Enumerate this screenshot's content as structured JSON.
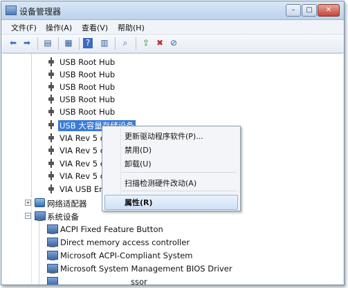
{
  "window": {
    "title": "设备管理器",
    "buttons": {
      "minimize": "–",
      "maximize": "□",
      "close": "✕"
    }
  },
  "menubar": {
    "items": [
      "文件(F)",
      "操作(A)",
      "查看(V)",
      "帮助(H)"
    ]
  },
  "toolbar": {
    "icons": [
      "back-arrow-icon",
      "forward-arrow-icon",
      "console-tree-icon",
      "properties-icon",
      "help-icon",
      "show-hide-icon",
      "scan-hardware-icon",
      "update-driver-icon",
      "uninstall-icon",
      "disable-icon"
    ]
  },
  "tree": {
    "usb_items": [
      "USB Root Hub",
      "USB Root Hub",
      "USB Root Hub",
      "USB Root Hub",
      "USB Root Hub",
      "USB 大容量存储设备",
      "VIA Rev 5 o",
      "VIA Rev 5 o",
      "VIA Rev 5 o",
      "VIA Rev 5 o",
      "VIA USB En"
    ],
    "network_category": "网络适配器",
    "system_category": "系统设备",
    "system_items": [
      "ACPI Fixed Feature Button",
      "Direct memory access controller",
      "Microsoft ACPI-Compliant System",
      "Microsoft System Management BIOS Driver",
      "ssor"
    ]
  },
  "context_menu": {
    "update_driver": "更新驱动程序软件(P)...",
    "disable": "禁用(D)",
    "uninstall": "卸载(U)",
    "scan": "扫描检测硬件改动(A)",
    "properties": "属性(R)"
  }
}
